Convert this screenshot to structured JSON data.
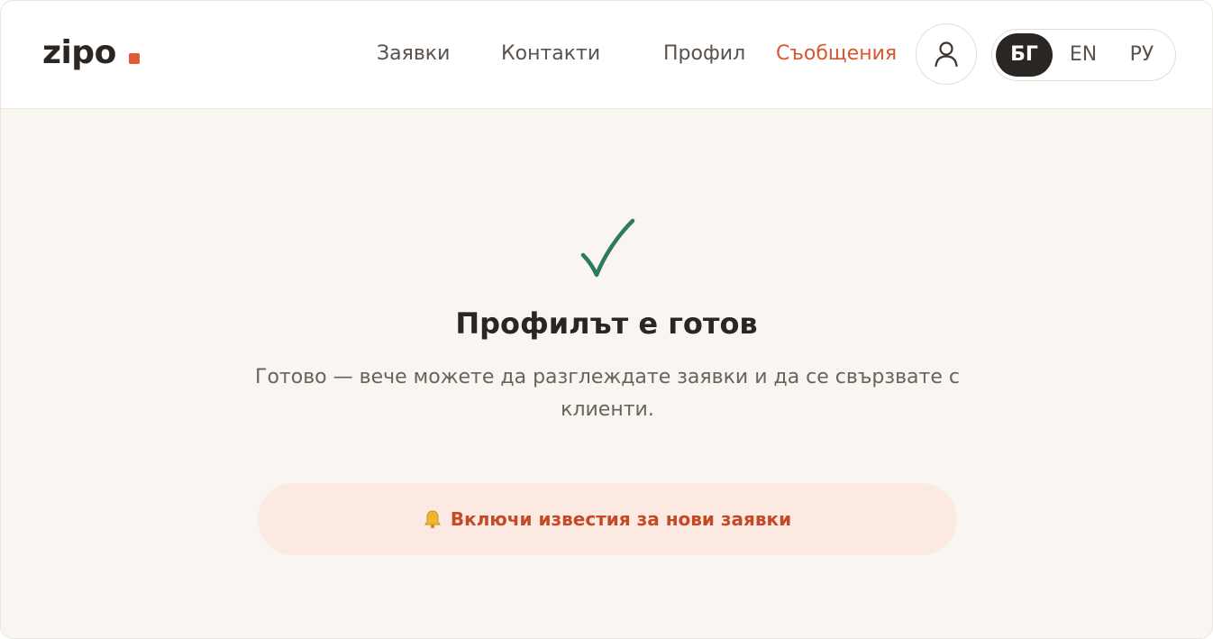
{
  "brand": {
    "name": "zipo",
    "accent": "#e05a33"
  },
  "nav": {
    "items": [
      {
        "label": "Заявки",
        "active": false
      },
      {
        "label": "Контакти",
        "active": false
      },
      {
        "label": "Профил",
        "active": false
      },
      {
        "label": "Съобщения",
        "active": true
      }
    ]
  },
  "account": {
    "icon": "user-icon"
  },
  "languages": {
    "options": [
      "БГ",
      "EN",
      "РУ"
    ],
    "selected": "БГ"
  },
  "success": {
    "icon": "checkmark-icon",
    "icon_color": "#2e7a5c",
    "title": "Профилът е готов",
    "description": "Готово — вече можете да разглеждате заявки и да се свързвате с клиенти."
  },
  "notify_button": {
    "icon": "bell-icon",
    "label": "Включи известия за нови заявки"
  },
  "colors": {
    "background": "#f9f5f1",
    "text_dark": "#2b2622",
    "active_link": "#d9572f",
    "button_bg": "#fbe9e2"
  }
}
